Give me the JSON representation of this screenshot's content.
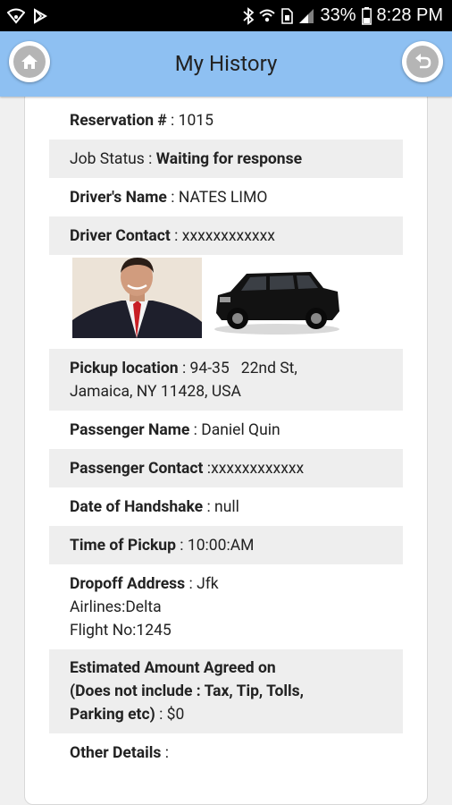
{
  "status_bar": {
    "battery": "33%",
    "time": "8:28 PM",
    "icons": [
      "wifi-signal-icon",
      "play-store-icon",
      "bluetooth-icon",
      "wifi-icon",
      "sim-icon",
      "cell-signal-icon",
      "battery-icon"
    ]
  },
  "header": {
    "title": "My History",
    "home_icon": "home-icon",
    "back_icon": "back-arrow-icon",
    "color": "#8ec0f2"
  },
  "details": {
    "reservation": {
      "label": "Reservation #",
      "sep": " : ",
      "value": "1015"
    },
    "job_status": {
      "label": "Job Status",
      "sep": " : ",
      "value": "Waiting for response"
    },
    "driver_name": {
      "label": "Driver's Name",
      "sep": " : ",
      "value": "NATES LIMO"
    },
    "driver_contact": {
      "label": "Driver Contact",
      "sep": " : ",
      "value": "xxxxxxxxxxxx"
    },
    "pickup_location": {
      "label": "Pickup location",
      "sep": " : ",
      "value_line1": "94-35   22nd St,",
      "value_line2": "Jamaica, NY 11428, USA"
    },
    "passenger_name": {
      "label": "Passenger Name",
      "sep": " : ",
      "value": "Daniel Quin"
    },
    "passenger_contact": {
      "label": "Passenger Contact",
      "sep": " :",
      "value": "xxxxxxxxxxxx"
    },
    "date_handshake": {
      "label": "Date of Handshake",
      "sep": " : ",
      "value": "null"
    },
    "time_pickup": {
      "label": "Time of Pickup",
      "sep": " : ",
      "value": "10:00:AM"
    },
    "dropoff": {
      "label": "Dropoff Address",
      "sep": " : ",
      "value": "Jfk",
      "airlines": "Airlines:Delta",
      "flight": "Flight No:1245"
    },
    "estimated": {
      "label_line1": "Estimated Amount Agreed on",
      "label_line2": "(Does not include : Tax, Tip, Tolls,",
      "label_line3": "Parking etc)",
      "sep": " : ",
      "value": "$0"
    },
    "other": {
      "label": "Other Details",
      "sep": " :"
    }
  }
}
